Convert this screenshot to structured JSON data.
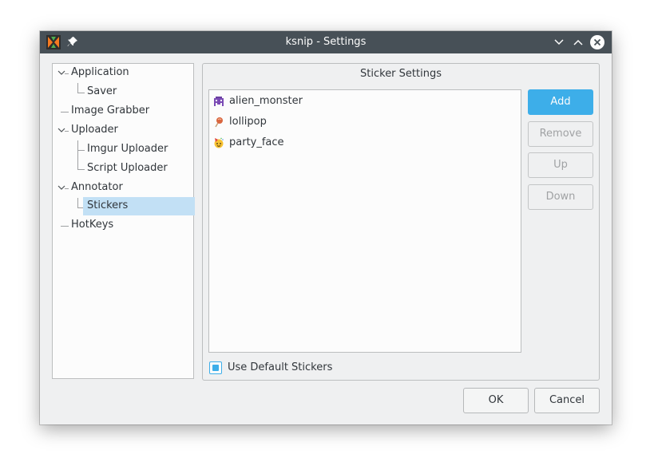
{
  "window": {
    "title": "ksnip - Settings",
    "accent": "#3daee9",
    "titlebar_color": "#475057"
  },
  "titlebar_icons": [
    "ksnip-app-icon",
    "pin-icon",
    "chevron-down-icon",
    "chevron-up-icon",
    "close-icon"
  ],
  "tree": {
    "items": [
      {
        "label": "Application",
        "level": 0,
        "expanded": true
      },
      {
        "label": "Saver",
        "level": 1
      },
      {
        "label": "Image Grabber",
        "level": 0
      },
      {
        "label": "Uploader",
        "level": 0,
        "expanded": true
      },
      {
        "label": "Imgur Uploader",
        "level": 1
      },
      {
        "label": "Script Uploader",
        "level": 1
      },
      {
        "label": "Annotator",
        "level": 0,
        "expanded": true
      },
      {
        "label": "Stickers",
        "level": 1,
        "selected": true
      },
      {
        "label": "HotKeys",
        "level": 0
      }
    ]
  },
  "sticker_settings": {
    "title": "Sticker Settings",
    "stickers": [
      {
        "label": "alien_monster",
        "icon": "alien-monster-icon"
      },
      {
        "label": "lollipop",
        "icon": "lollipop-icon"
      },
      {
        "label": "party_face",
        "icon": "party-face-icon"
      }
    ],
    "buttons": {
      "add": "Add",
      "remove": "Remove",
      "up": "Up",
      "down": "Down"
    },
    "use_default_label": "Use Default Stickers",
    "use_default_checked": true
  },
  "dialog_buttons": {
    "ok": "OK",
    "cancel": "Cancel"
  }
}
